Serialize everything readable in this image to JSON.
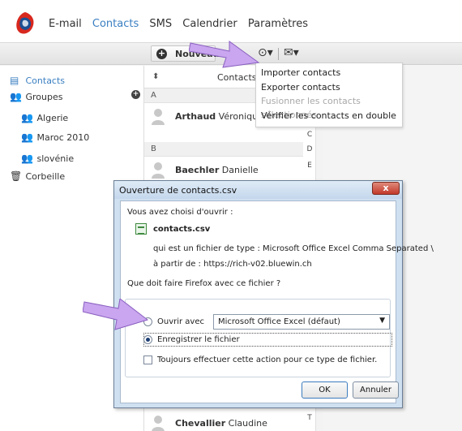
{
  "nav": {
    "links": [
      "E-mail",
      "Contacts",
      "SMS",
      "Calendrier",
      "Paramètres"
    ],
    "active": "Contacts"
  },
  "toolbar": {
    "new_label": "Nouveau",
    "gear_glyph": "⊙▾",
    "mail_glyph": "✉▾"
  },
  "menu": {
    "items": [
      {
        "label": "Importer contacts",
        "enabled": true
      },
      {
        "label": "Exporter contacts",
        "enabled": true
      },
      {
        "label": "Fusionner les contacts sélectionnés",
        "enabled": false
      },
      {
        "label": "Vérifier les contacts en double",
        "enabled": true
      }
    ]
  },
  "sidebar": {
    "contacts": "Contacts",
    "groups": "Groupes",
    "group_items": [
      "Algerie",
      "Maroc 2010",
      "slovénie"
    ],
    "trash": "Corbeille"
  },
  "contacts_list": {
    "header": "Contacts",
    "sections": [
      {
        "letter": "A",
        "names": [
          {
            "last": "Arthaud",
            "first": "Véronique"
          }
        ]
      },
      {
        "letter": "B",
        "names": [
          {
            "last": "Baechler",
            "first": "Danielle"
          }
        ]
      }
    ],
    "bottom_contact": {
      "last": "Chevallier",
      "first": "Claudine"
    },
    "index_letters": [
      "C",
      "D",
      "E",
      "T"
    ]
  },
  "dialog": {
    "title": "Ouverture de contacts.csv",
    "close_glyph": "x",
    "intro": "Vous avez choisi d'ouvrir :",
    "filename": "contacts.csv",
    "type_line": "qui est un fichier de type :  Microsoft Office Excel Comma Separated \\",
    "from_line": "à partir de :  https://rich-v02.bluewin.ch",
    "question": "Que doit faire Firefox avec ce fichier ?",
    "open_with_label": "Ouvrir avec",
    "open_with_value": "Microsoft Office Excel (défaut)",
    "save_label": "Enregistrer le fichier",
    "always_label": "Toujours effectuer cette action pour ce type de fichier.",
    "ok": "OK",
    "cancel": "Annuler",
    "selected_option": "save"
  },
  "colors": {
    "accent": "#3a7fc1",
    "arrow": "#c9a6ef",
    "brand_red": "#d8281e"
  }
}
